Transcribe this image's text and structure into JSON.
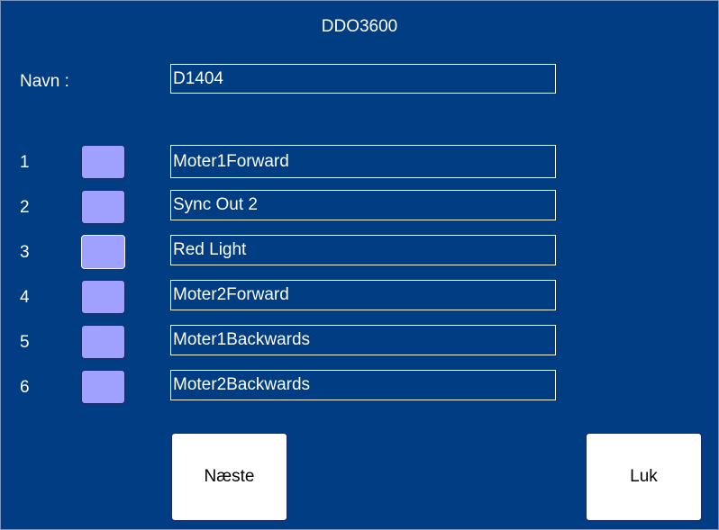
{
  "window": {
    "title": "DDO3600"
  },
  "name_row": {
    "label": "Navn :",
    "value": "D1404"
  },
  "channels": [
    {
      "number": "1",
      "name": "Moter1Forward",
      "active": false
    },
    {
      "number": "2",
      "name": "Sync Out 2",
      "active": false
    },
    {
      "number": "3",
      "name": "Red Light",
      "active": true
    },
    {
      "number": "4",
      "name": "Moter2Forward",
      "active": false
    },
    {
      "number": "5",
      "name": "Moter1Backwards",
      "active": false
    },
    {
      "number": "6",
      "name": "Moter2Backwards",
      "active": false
    }
  ],
  "buttons": {
    "next_label": "Næste",
    "close_label": "Luk"
  },
  "colors": {
    "background": "#003d82",
    "toggle_fill": "#a0a0ff",
    "field_border": "#ffffff",
    "button_fill": "#ffffff"
  }
}
